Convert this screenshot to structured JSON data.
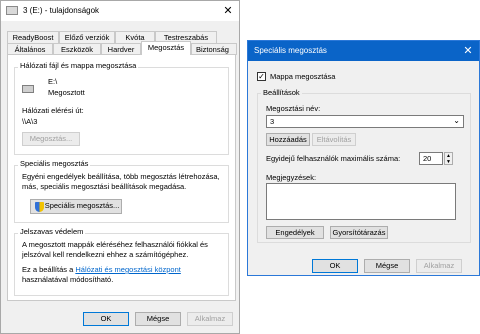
{
  "props": {
    "title": "3 (E:) - tulajdonságok",
    "tabs_row1": [
      "ReadyBoost",
      "Előző verziók",
      "Kvóta",
      "Testreszabás"
    ],
    "tabs_row2": [
      "Általános",
      "Eszközök",
      "Hardver",
      "Megosztás",
      "Biztonság"
    ],
    "network": {
      "legend": "Hálózati fájl és mappa megosztása",
      "drive": "E:\\",
      "status": "Megosztott",
      "path_label": "Hálózati elérési út:",
      "path_value": "\\\\A\\3",
      "share_button": "Megosztás..."
    },
    "advanced": {
      "legend": "Speciális megosztás",
      "desc": "Egyéni engedélyek beállítása, több megosztás létrehozása, más, speciális megosztási beállítások megadása.",
      "button": "Speciális megosztás..."
    },
    "password": {
      "legend": "Jelszavas védelem",
      "desc": "A megosztott mappák eléréséhez felhasználói fiókkal és jelszóval kell rendelkezni ehhez a számítógéphez.",
      "link_prefix": "Ez a beállítás a",
      "link_text": "Hálózati és megosztási központ",
      "link_suffix": "használatával módosítható."
    },
    "buttons": {
      "ok": "OK",
      "cancel": "Mégse",
      "apply": "Alkalmaz"
    }
  },
  "adv": {
    "title": "Speciális megosztás",
    "share_checkbox": "Mappa megosztása",
    "settings_legend": "Beállítások",
    "share_name_label": "Megosztási név:",
    "share_name_value": "3",
    "add_button": "Hozzáadás",
    "remove_button": "Eltávolítás",
    "limit_label": "Egyidejű felhasználók maximális száma:",
    "limit_value": "20",
    "comments_label": "Megjegyzések:",
    "permissions_button": "Engedélyek",
    "caching_button": "Gyorsítótárazás",
    "buttons": {
      "ok": "OK",
      "cancel": "Mégse",
      "apply": "Alkalmaz"
    }
  }
}
